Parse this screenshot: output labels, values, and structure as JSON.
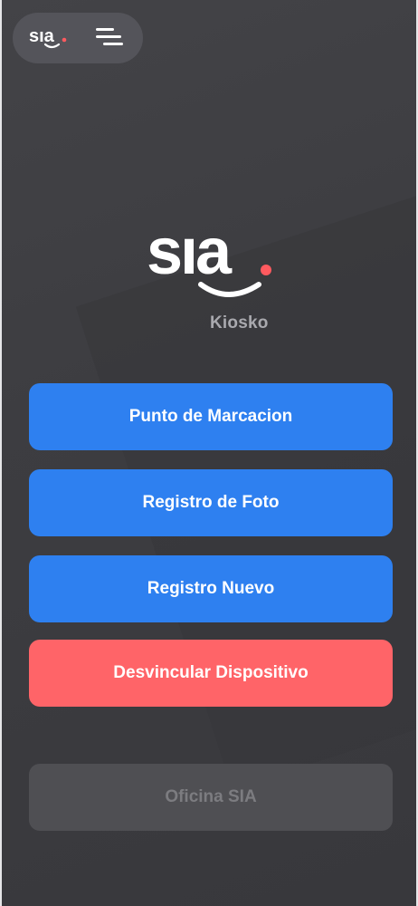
{
  "app": {
    "logo_text": "SIA",
    "subtitle": "Kiosko"
  },
  "header": {
    "logo_icon": "sia-logo-icon",
    "menu_icon": "menu-icon"
  },
  "actions": [
    {
      "label": "Punto de Marcacion",
      "color": "#2e80f0"
    },
    {
      "label": "Registro de Foto",
      "color": "#2e80f0"
    },
    {
      "label": "Registro Nuevo",
      "color": "#2e80f0"
    },
    {
      "label": "Desvincular Dispositivo",
      "color": "#ff6468"
    }
  ],
  "footer": {
    "office_label": "Oficina SIA",
    "office_enabled": false
  },
  "colors": {
    "background": "#3c3c40",
    "primary": "#2e80f0",
    "danger": "#ff6468",
    "logo_dot": "#ff5a5f",
    "disabled": "#4f4f53"
  }
}
